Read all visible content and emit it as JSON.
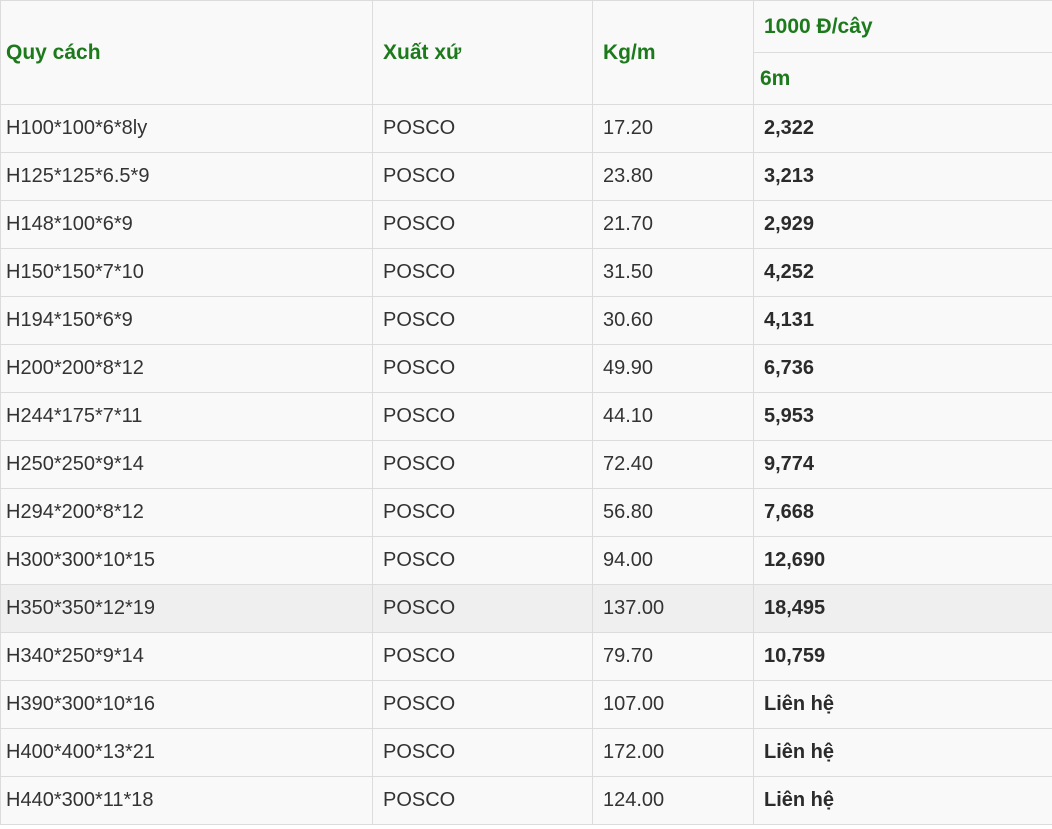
{
  "table": {
    "headers": {
      "spec": "Quy cách",
      "origin": "Xuất xứ",
      "kg_per_m": "Kg/m",
      "price_unit": "1000 Đ/cây",
      "length": "6m"
    },
    "rows": [
      {
        "spec": "H100*100*6*8ly",
        "origin": "POSCO",
        "kg": "17.20",
        "price": "2,322"
      },
      {
        "spec": "H125*125*6.5*9",
        "origin": "POSCO",
        "kg": "23.80",
        "price": "3,213"
      },
      {
        "spec": "H148*100*6*9",
        "origin": "POSCO",
        "kg": "21.70",
        "price": "2,929"
      },
      {
        "spec": "H150*150*7*10",
        "origin": "POSCO",
        "kg": "31.50",
        "price": "4,252"
      },
      {
        "spec": "H194*150*6*9",
        "origin": "POSCO",
        "kg": "30.60",
        "price": "4,131"
      },
      {
        "spec": "H200*200*8*12",
        "origin": "POSCO",
        "kg": "49.90",
        "price": "6,736"
      },
      {
        "spec": "H244*175*7*11",
        "origin": "POSCO",
        "kg": "44.10",
        "price": "5,953"
      },
      {
        "spec": "H250*250*9*14",
        "origin": "POSCO",
        "kg": "72.40",
        "price": "9,774"
      },
      {
        "spec": "H294*200*8*12",
        "origin": "POSCO",
        "kg": "56.80",
        "price": "7,668"
      },
      {
        "spec": "H300*300*10*15",
        "origin": "POSCO",
        "kg": "94.00",
        "price": "12,690"
      },
      {
        "spec": "H350*350*12*19",
        "origin": "POSCO",
        "kg": "137.00",
        "price": "18,495"
      },
      {
        "spec": "H340*250*9*14",
        "origin": "POSCO",
        "kg": "79.70",
        "price": "10,759"
      },
      {
        "spec": "H390*300*10*16",
        "origin": "POSCO",
        "kg": "107.00",
        "price": "Liên hệ"
      },
      {
        "spec": "H400*400*13*21",
        "origin": "POSCO",
        "kg": "172.00",
        "price": "Liên hệ"
      },
      {
        "spec": "H440*300*11*18",
        "origin": "POSCO",
        "kg": "124.00",
        "price": "Liên hệ"
      }
    ]
  },
  "colors": {
    "header_text": "#1c7a1c",
    "body_text": "#333333",
    "border": "#dcdcdc",
    "highlight_row": "#efefef"
  }
}
